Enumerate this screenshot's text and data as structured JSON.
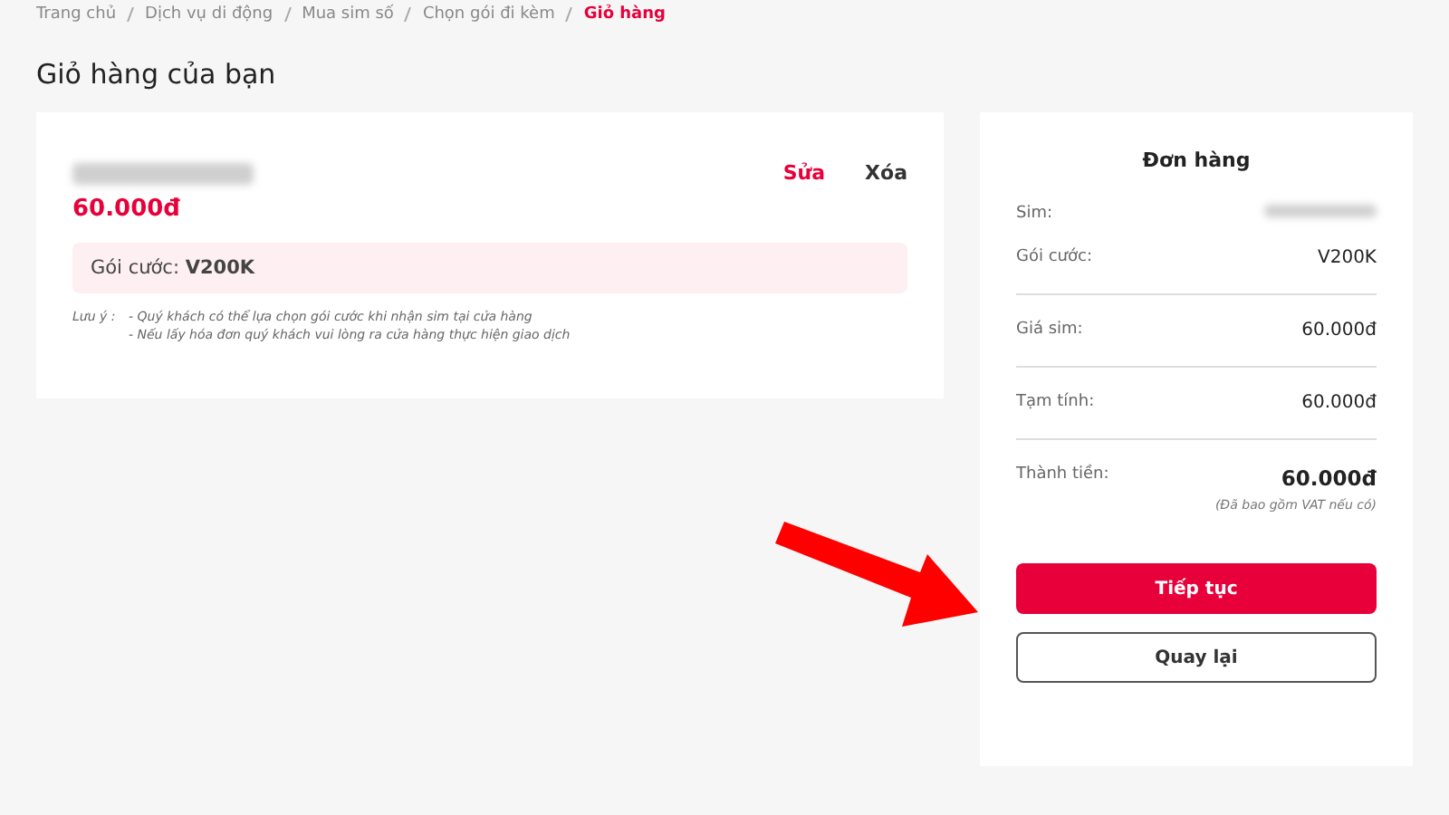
{
  "breadcrumb": [
    {
      "label": "Trang chủ",
      "current": false
    },
    {
      "label": "Dịch vụ di động",
      "current": false
    },
    {
      "label": "Mua sim số",
      "current": false
    },
    {
      "label": "Chọn gói đi kèm",
      "current": false
    },
    {
      "label": "Giỏ hàng",
      "current": true
    }
  ],
  "title": "Giỏ hàng của bạn",
  "cart_item": {
    "price": "60.000đ",
    "edit": "Sửa",
    "delete": "Xóa",
    "package_label": "Gói cước:",
    "package_value": "V200K",
    "note_label": "Lưu ý :",
    "notes": [
      "- Quý khách có thể lựa chọn gói cước khi nhận sim tại cửa hàng",
      "- Nếu lấy hóa đơn quý khách vui lòng ra cửa hàng thực hiện giao dịch"
    ]
  },
  "order": {
    "title": "Đơn hàng",
    "rows": [
      {
        "kind": "redacted",
        "label": "Sim:"
      },
      {
        "kind": "plain",
        "label": "Gói cước:",
        "value": "V200K"
      },
      {
        "kind": "divider"
      },
      {
        "kind": "plain",
        "label": "Giá sim:",
        "value": "60.000đ"
      },
      {
        "kind": "divider"
      },
      {
        "kind": "plain",
        "label": "Tạm tính:",
        "value": "60.000đ"
      },
      {
        "kind": "divider"
      },
      {
        "kind": "total",
        "label": "Thành tiền:",
        "value": "60.000đ",
        "note": "(Đã bao gồm VAT nếu có)"
      }
    ],
    "primary_button": "Tiếp tục",
    "secondary_button": "Quay lại"
  }
}
